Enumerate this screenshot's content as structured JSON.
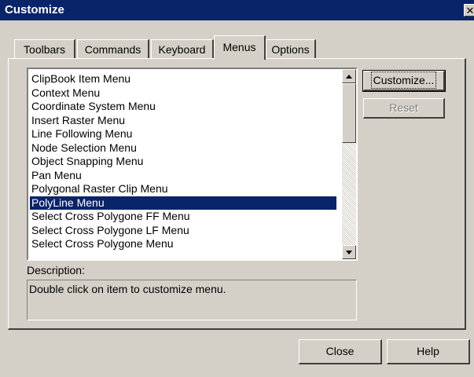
{
  "window": {
    "title": "Customize",
    "close_glyph": "✕"
  },
  "tabs": [
    {
      "label": "Toolbars",
      "active": false
    },
    {
      "label": "Commands",
      "active": false
    },
    {
      "label": "Keyboard",
      "active": false
    },
    {
      "label": "Menus",
      "active": true
    },
    {
      "label": "Options",
      "active": false
    }
  ],
  "menu_list": {
    "items": [
      "ClipBook Item Menu",
      "Context Menu",
      "Coordinate System Menu",
      "Insert Raster Menu",
      "Line Following Menu",
      "Node Selection Menu",
      "Object Snapping Menu",
      "Pan Menu",
      "Polygonal Raster Clip Menu",
      "PolyLine Menu",
      "Select Cross Polygone FF Menu",
      "Select Cross Polygone LF Menu",
      "Select Cross Polygone Menu"
    ],
    "selected_item": "PolyLine Menu"
  },
  "buttons": {
    "customize": "Customize...",
    "reset": "Reset",
    "close": "Close",
    "help": "Help"
  },
  "description": {
    "label": "Description:",
    "text": "Double click on item to customize menu."
  },
  "colors": {
    "titlebar": "#0a246a",
    "selection": "#0a246a",
    "face": "#d4d0c8"
  }
}
